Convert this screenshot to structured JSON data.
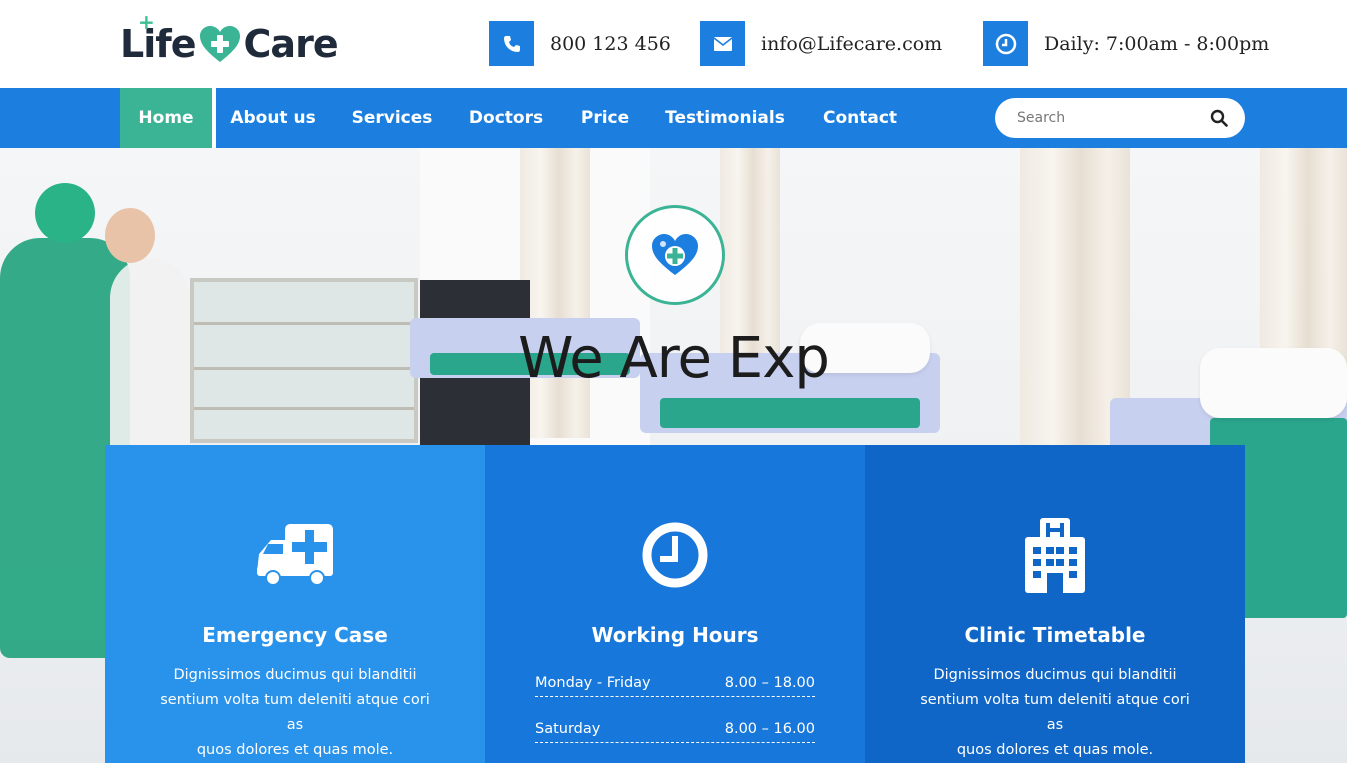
{
  "brand": {
    "logo_left": "Life",
    "logo_right": "Care",
    "accent": "#3bb395",
    "primary": "#1c7fe0"
  },
  "contact": {
    "phone": {
      "icon": "phone-icon",
      "text": "800 123 456"
    },
    "email": {
      "icon": "envelope-icon",
      "text": "info@Lifecare.com"
    },
    "hours": {
      "icon": "clock-icon",
      "text": "Daily: 7:00am - 8:00pm"
    }
  },
  "nav": {
    "items": [
      {
        "label": "Home",
        "active": true
      },
      {
        "label": "About us"
      },
      {
        "label": "Services"
      },
      {
        "label": "Doctors"
      },
      {
        "label": "Price"
      },
      {
        "label": "Testimonials"
      },
      {
        "label": "Contact"
      }
    ],
    "search_placeholder": "Search"
  },
  "hero": {
    "badge_icon": "heart-plus-icon",
    "title": "We Are Exp"
  },
  "features": [
    {
      "icon": "ambulance-icon",
      "title": "Emergency Case",
      "text": [
        "Dignissimos ducimus qui blanditii",
        "sentium volta tum deleniti atque cori as",
        "quos dolores et quas mole."
      ]
    },
    {
      "icon": "clock-icon",
      "title": "Working Hours",
      "hours": [
        {
          "day": "Monday - Friday",
          "time": "8.00 – 18.00"
        },
        {
          "day": "Saturday",
          "time": "8.00 – 16.00"
        }
      ]
    },
    {
      "icon": "hospital-icon",
      "title": "Clinic Timetable",
      "text": [
        "Dignissimos ducimus qui blanditii",
        "sentium volta tum deleniti atque cori as",
        "quos dolores et quas mole."
      ]
    }
  ]
}
